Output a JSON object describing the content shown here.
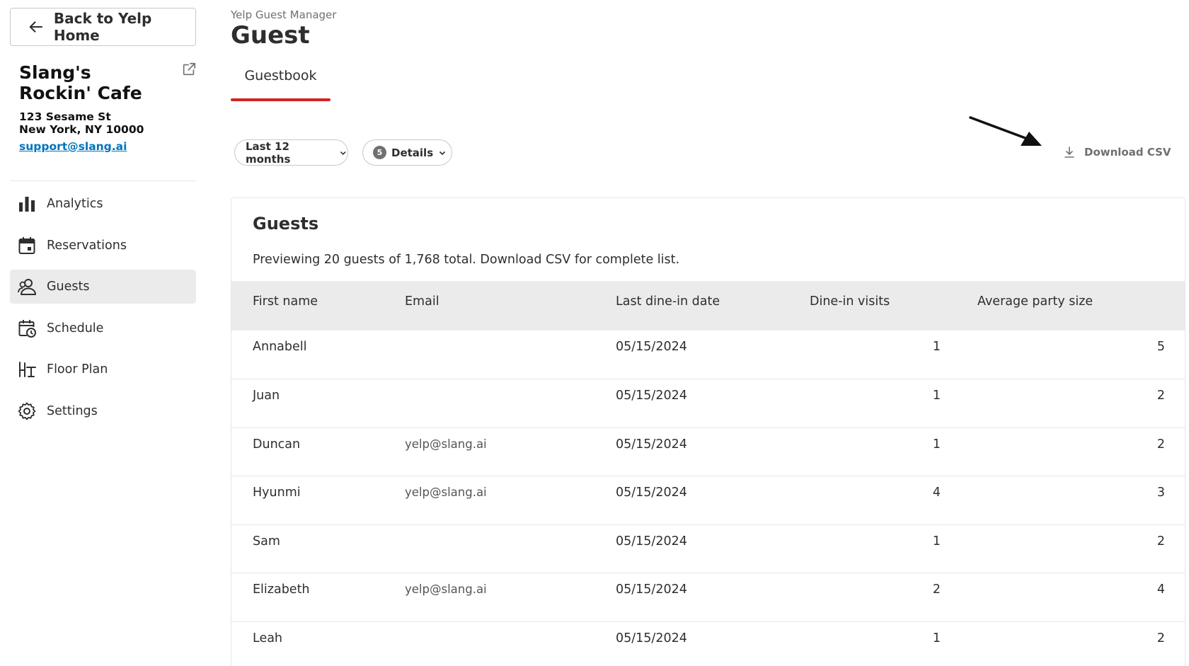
{
  "sidebar": {
    "back_label": "Back to Yelp Home",
    "business_name": "Slang's Rockin' Cafe",
    "address_line1": "123 Sesame St",
    "address_line2": "New York, NY 10000",
    "support_email": "support@slang.ai",
    "nav": [
      {
        "label": "Analytics",
        "icon": "bar-chart-icon"
      },
      {
        "label": "Reservations",
        "icon": "calendar-icon"
      },
      {
        "label": "Guests",
        "icon": "guests-icon",
        "active": true
      },
      {
        "label": "Schedule",
        "icon": "schedule-icon"
      },
      {
        "label": "Floor Plan",
        "icon": "floor-plan-icon"
      },
      {
        "label": "Settings",
        "icon": "gear-icon"
      }
    ]
  },
  "header": {
    "eyebrow": "Yelp Guest Manager",
    "title": "Guest",
    "tab": "Guestbook"
  },
  "filters": {
    "range_label": "Last 12 months",
    "details_count": "5",
    "details_label": "Details",
    "download_label": "Download CSV"
  },
  "guests": {
    "title": "Guests",
    "subtitle": "Previewing 20 guests of 1,768 total. Download CSV for complete list.",
    "columns": [
      "First name",
      "Email",
      "Last dine-in date",
      "Dine-in visits",
      "Average party size"
    ],
    "rows": [
      [
        "Annabell",
        "",
        "05/15/2024",
        "1",
        "5"
      ],
      [
        "Juan",
        "",
        "05/15/2024",
        "1",
        "2"
      ],
      [
        "Duncan",
        "yelp@slang.ai",
        "05/15/2024",
        "1",
        "2"
      ],
      [
        "Hyunmi",
        "yelp@slang.ai",
        "05/15/2024",
        "4",
        "3"
      ],
      [
        "Sam",
        "",
        "05/15/2024",
        "1",
        "2"
      ],
      [
        "Elizabeth",
        "yelp@slang.ai",
        "05/15/2024",
        "2",
        "4"
      ],
      [
        "Leah",
        "",
        "05/15/2024",
        "1",
        "2"
      ]
    ]
  },
  "colors": {
    "accent": "#d32323",
    "link": "#0073bb",
    "text": "#2d2e2f",
    "muted": "#6e7072"
  }
}
